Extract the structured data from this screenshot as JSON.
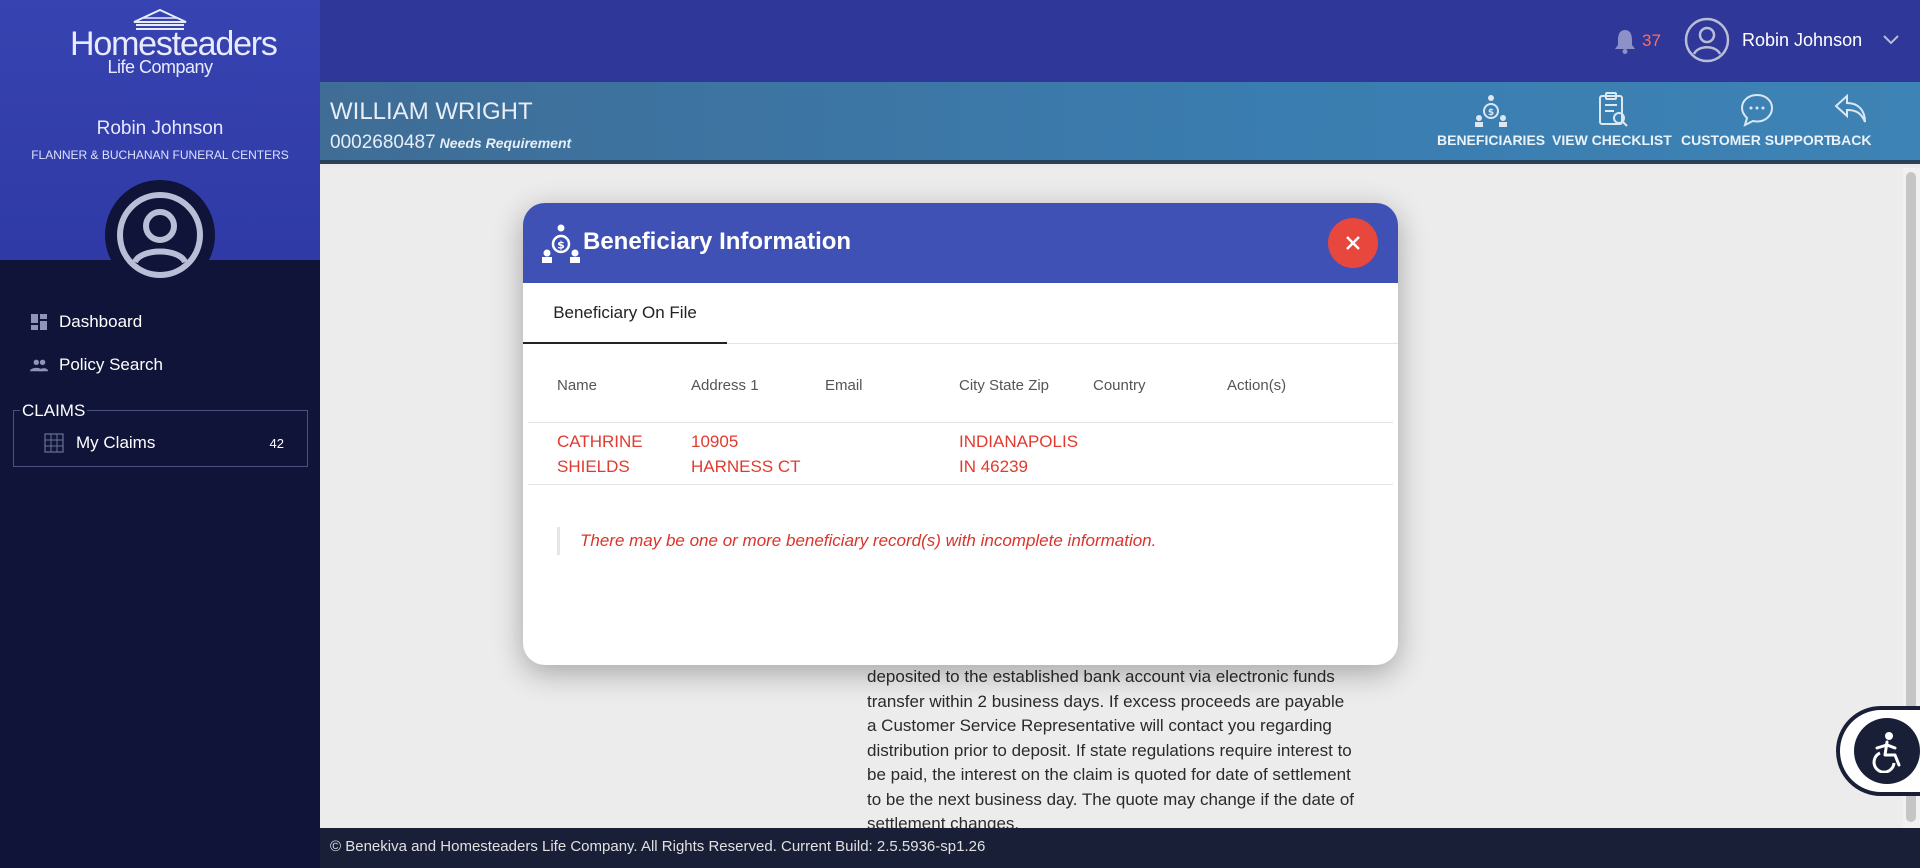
{
  "sidebar": {
    "logo": {
      "line1": "Homesteaders",
      "line2": "Life Company"
    },
    "user_name": "Robin Johnson",
    "user_org": "FLANNER & BUCHANAN FUNERAL CENTERS",
    "nav": [
      {
        "label": "Dashboard",
        "icon": "dashboard-icon"
      },
      {
        "label": "Policy Search",
        "icon": "people-icon"
      }
    ],
    "claims": {
      "legend": "CLAIMS",
      "label": "My Claims",
      "count": "42",
      "icon": "grid-icon"
    }
  },
  "topbar": {
    "notification_count": "37",
    "user_name": "Robin Johnson"
  },
  "case": {
    "name": "WILLIAM WRIGHT",
    "number": "0002680487",
    "status": "Needs Requirement",
    "actions": [
      {
        "label": "BENEFICIARIES",
        "icon": "beneficiaries-icon"
      },
      {
        "label": "VIEW CHECKLIST",
        "icon": "checklist-icon"
      },
      {
        "label": "CUSTOMER SUPPORT",
        "icon": "chat-icon"
      },
      {
        "label": "BACK",
        "icon": "back-icon"
      }
    ]
  },
  "background_text": "deposited to the established bank account via electronic funds transfer within 2 business days. If excess proceeds are payable a Customer Service Representative will contact you regarding distribution prior to deposit. If state regulations require interest to be paid, the interest on the claim is quoted for date of settlement to be the next business day. The quote may change if the date of settlement changes.",
  "footer": "© Benekiva and Homesteaders Life Company. All Rights Reserved. Current Build: 2.5.5936-sp1.26",
  "modal": {
    "title": "Beneficiary Information",
    "tab": "Beneficiary On File",
    "columns": [
      "Name",
      "Address 1",
      "Email",
      "City State Zip",
      "Country",
      "Action(s)"
    ],
    "rows": [
      {
        "name_line1": "CATHRINE",
        "name_line2": "SHIELDS",
        "address_line1": "10905",
        "address_line2": "HARNESS CT",
        "email": "",
        "city_line1": "INDIANAPOLIS",
        "city_line2": "IN 46239",
        "country": "",
        "actions": ""
      }
    ],
    "warning": "There may be one or more beneficiary record(s) with incomplete information."
  },
  "colors": {
    "sidebar_bg": "#0f1438",
    "topbar_bg": "#2f3798",
    "modal_header": "#3f51b5",
    "close_button": "#e8473d",
    "error_text": "#e23a2f",
    "notification": "#ff6b5c"
  }
}
